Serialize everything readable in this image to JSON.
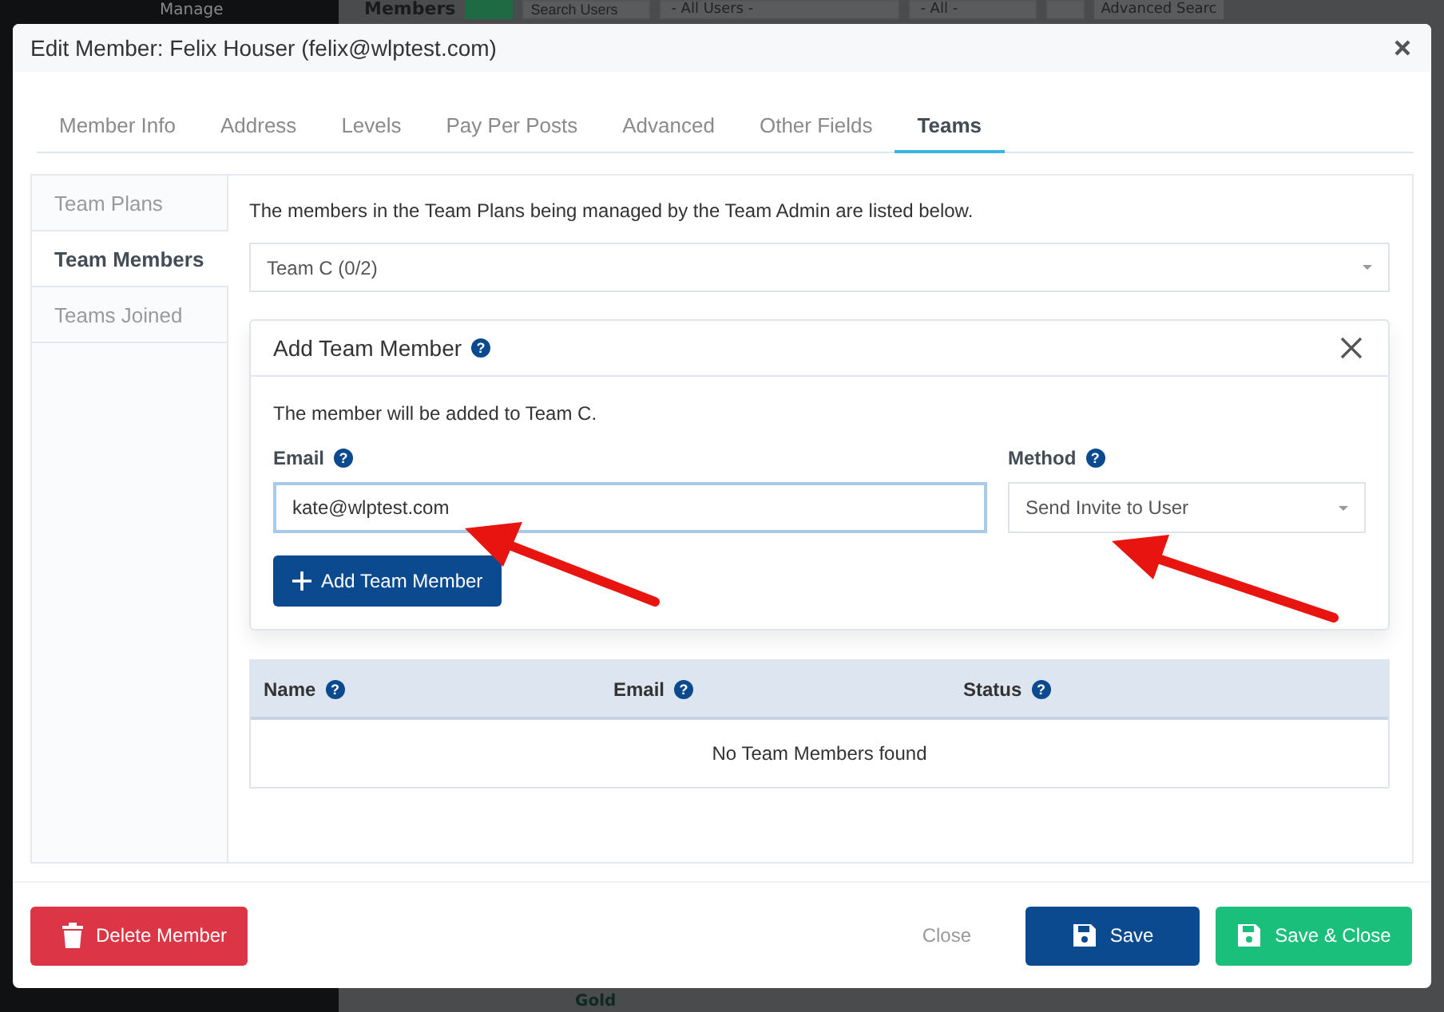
{
  "background": {
    "menu_item": "Manage",
    "page_title": "Members",
    "search": {
      "placeholder": "Search Users"
    },
    "filter_1": "- All Users -",
    "filter_2": "- All -",
    "advanced": "Advanced Searc",
    "tree_item": "Gold"
  },
  "modal": {
    "title": "Edit Member: Felix Houser (felix@wlptest.com)",
    "tabs": [
      {
        "label": "Member Info",
        "selected": false
      },
      {
        "label": "Address",
        "selected": false
      },
      {
        "label": "Levels",
        "selected": false
      },
      {
        "label": "Pay Per Posts",
        "selected": false
      },
      {
        "label": "Advanced",
        "selected": false
      },
      {
        "label": "Other Fields",
        "selected": false
      },
      {
        "label": "Teams",
        "selected": true
      }
    ],
    "side_nav": [
      {
        "label": "Team Plans",
        "selected": false
      },
      {
        "label": "Team Members",
        "selected": true
      },
      {
        "label": "Teams Joined",
        "selected": false
      }
    ],
    "intro": "The members in the Team Plans being managed by the Team Admin are listed below.",
    "team_select": "Team C (0/2)",
    "add_panel": {
      "title": "Add Team Member",
      "title_help": "?",
      "note": "The member will be added to Team C.",
      "email_label": "Email",
      "email_help": "?",
      "email_value": "kate@wlptest.com",
      "method_label": "Method",
      "method_help": "?",
      "method_value": "Send Invite to User",
      "add_button": "Add Team Member"
    },
    "table": {
      "columns": [
        {
          "label": "Name",
          "help": "?"
        },
        {
          "label": "Email",
          "help": "?"
        },
        {
          "label": "Status",
          "help": "?"
        }
      ],
      "empty": "No Team Members found"
    },
    "footer": {
      "delete": "Delete Member",
      "close": "Close",
      "save": "Save",
      "save_close": "Save & Close"
    }
  }
}
